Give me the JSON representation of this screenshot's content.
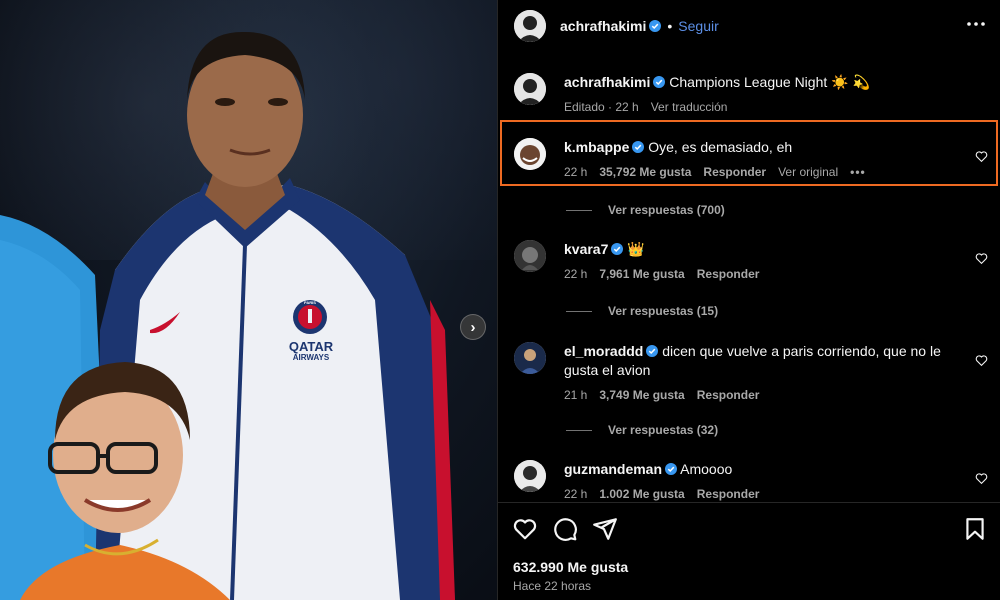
{
  "header": {
    "username": "achrafhakimi",
    "separator": "•",
    "follow_label": "Seguir",
    "more_icon": "more-horizontal-icon"
  },
  "caption": {
    "username": "achrafhakimi",
    "text": "Champions League Night ☀️ 💫",
    "edited": "Editado · 22 h",
    "translate": "Ver traducción"
  },
  "comments": [
    {
      "username": "k.mbappe",
      "text": "Oye, es demasiado, eh",
      "time": "22 h",
      "likes": "35,792 Me gusta",
      "reply": "Responder",
      "original": "Ver original",
      "more": "•••",
      "replies": "Ver respuestas (700)"
    },
    {
      "username": "kvara7",
      "text": "👑",
      "time": "22 h",
      "likes": "7,961 Me gusta",
      "reply": "Responder",
      "replies": "Ver respuestas (15)"
    },
    {
      "username": "el_moraddd",
      "text": "dicen que vuelve a paris corriendo, que no le gusta el avion",
      "time": "21 h",
      "likes": "3,749 Me gusta",
      "reply": "Responder",
      "replies": "Ver respuestas (32)"
    },
    {
      "username": "guzmandeman",
      "text": "Amoooo",
      "time": "22 h",
      "likes": "1.002 Me gusta",
      "reply": "Responder"
    }
  ],
  "footer": {
    "likes": "632.990 Me gusta",
    "time_ago": "Hace 22 horas"
  },
  "media": {
    "next_glyph": "›",
    "jacket_text_1": "QATAR",
    "jacket_text_2": "AIRWAYS",
    "crest_text": "PARIS"
  },
  "colors": {
    "accent": "#5c8fe6",
    "verified": "#3897f0",
    "highlight": "#ee6a22",
    "jacket_blue": "#1c3570",
    "jacket_white": "#eef0f5"
  }
}
